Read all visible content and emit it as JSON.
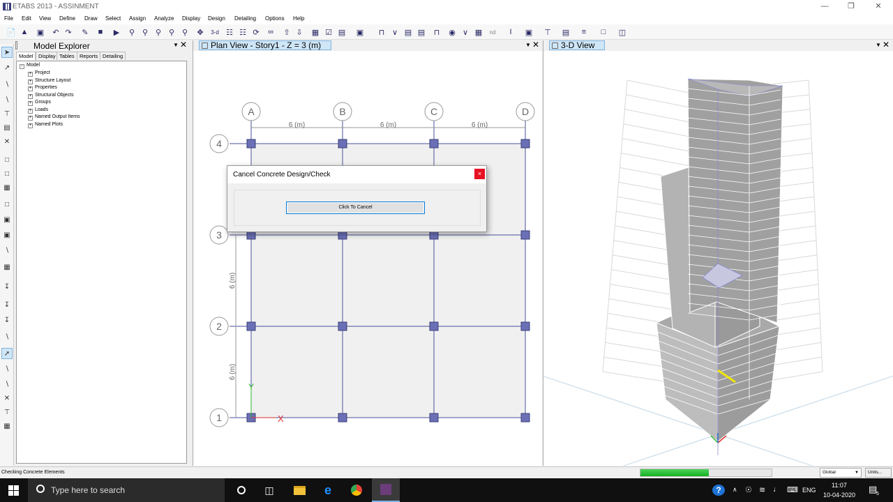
{
  "window": {
    "title": "ETABS 2013 - ASSINMENT"
  },
  "menu": [
    "File",
    "Edit",
    "View",
    "Define",
    "Draw",
    "Select",
    "Assign",
    "Analyze",
    "Display",
    "Design",
    "Detailing",
    "Options",
    "Help"
  ],
  "toolbar": {
    "view3d_label": "3-d",
    "nd_label": "nd"
  },
  "explorer": {
    "title": "Model Explorer",
    "tabs": [
      "Model",
      "Display",
      "Tables",
      "Reports",
      "Detailing"
    ],
    "root": "Model",
    "items": [
      "Project",
      "Structure Layout",
      "Properties",
      "Structural Objects",
      "Groups",
      "Loads",
      "Named Output Items",
      "Named Plots"
    ]
  },
  "plan_view": {
    "title": "Plan View - Story1 - Z = 3 (m)",
    "grid_x": [
      "A",
      "B",
      "C",
      "D"
    ],
    "grid_y": [
      "4",
      "3",
      "2",
      "1"
    ],
    "spacing_x": [
      "6 (m)",
      "6 (m)",
      "6 (m)"
    ],
    "spacing_y": [
      "6 (m)",
      "6 (m)"
    ],
    "axis_x": "X",
    "axis_y": "Y"
  },
  "view3d": {
    "title": "3-D View"
  },
  "dialog": {
    "title": "Cancel Concrete Design/Check",
    "button": "Click To Cancel",
    "close": "×"
  },
  "status": {
    "text": "Checking Concrete Elements",
    "progress": 0.52,
    "coord_system": "Global",
    "units_button": "Units..."
  },
  "taskbar": {
    "search_placeholder": "Type here to search",
    "language": "ENG",
    "time": "11:07",
    "date": "10-04-2020",
    "notification_count": "5"
  },
  "colors": {
    "joint": "#6b6fb5",
    "grid_line": "#4a4f9a",
    "axis_x": "#e03030",
    "axis_y": "#2fb52f",
    "progress": "#16b023"
  }
}
